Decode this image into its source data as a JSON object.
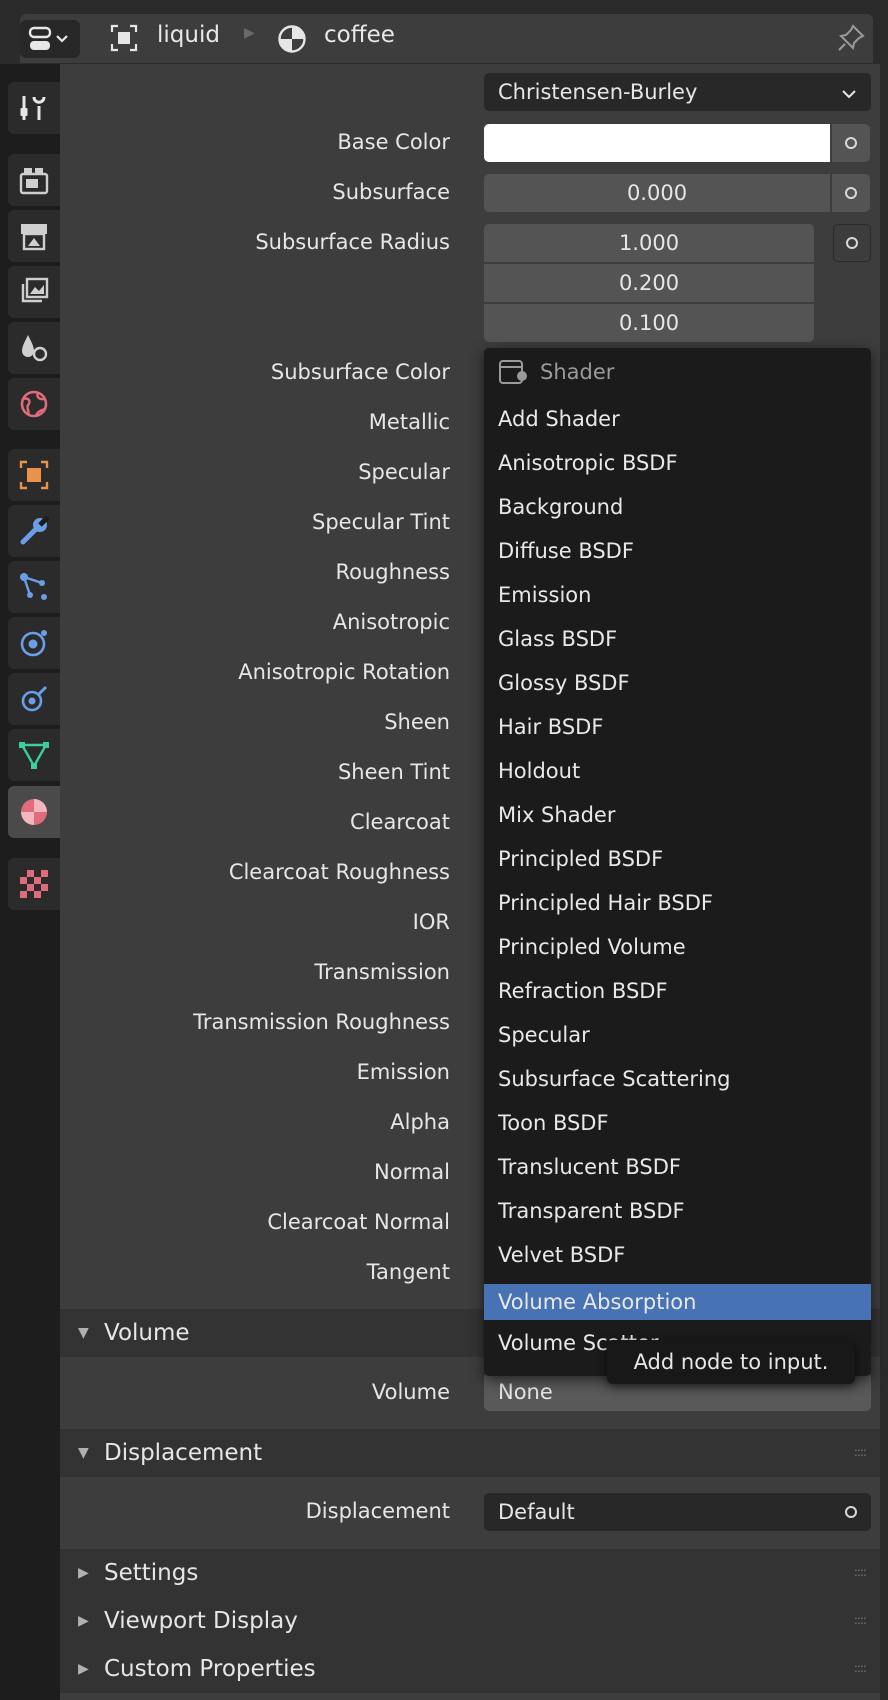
{
  "breadcrumb": {
    "object": "liquid",
    "material": "coffee"
  },
  "subsurface_method": "Christensen-Burley",
  "properties": {
    "base_color": {
      "label": "Base Color",
      "value": "#ffffff"
    },
    "subsurface": {
      "label": "Subsurface",
      "value": "0.000"
    },
    "subsurface_radius": {
      "label": "Subsurface Radius",
      "values": [
        "1.000",
        "0.200",
        "0.100"
      ]
    },
    "labels": [
      "Subsurface Color",
      "Metallic",
      "Specular",
      "Specular Tint",
      "Roughness",
      "Anisotropic",
      "Anisotropic Rotation",
      "Sheen",
      "Sheen Tint",
      "Clearcoat",
      "Clearcoat Roughness",
      "IOR",
      "Transmission",
      "Transmission Roughness",
      "Emission",
      "Alpha",
      "Normal",
      "Clearcoat Normal",
      "Tangent"
    ]
  },
  "menu": {
    "title": "Shader",
    "items": [
      "Add Shader",
      "Anisotropic BSDF",
      "Background",
      "Diffuse BSDF",
      "Emission",
      "Glass BSDF",
      "Glossy BSDF",
      "Hair BSDF",
      "Holdout",
      "Mix Shader",
      "Principled BSDF",
      "Principled Hair BSDF",
      "Principled Volume",
      "Refraction BSDF",
      "Specular",
      "Subsurface Scattering",
      "Toon BSDF",
      "Translucent BSDF",
      "Transparent BSDF",
      "Velvet BSDF",
      "Volume Absorption",
      "Volume Scatter"
    ],
    "highlighted": "Volume Absorption"
  },
  "tooltip": "Add node to input.",
  "panels": {
    "volume": {
      "title": "Volume",
      "label": "Volume",
      "value": "None"
    },
    "displacement": {
      "title": "Displacement",
      "label": "Displacement",
      "value": "Default"
    },
    "settings": "Settings",
    "viewport_display": "Viewport Display",
    "custom_properties": "Custom Properties"
  },
  "tabs": [
    "tool-icon",
    "render-icon",
    "output-icon",
    "view-layer-icon",
    "scene-icon",
    "world-icon",
    "object-icon",
    "modifier-icon",
    "particles-icon",
    "physics-icon",
    "constraints-icon",
    "data-icon",
    "material-icon",
    "texture-icon"
  ],
  "colors": {
    "highlight": "#4772b3",
    "material_tab": "#e06c7b",
    "object_tab": "#e8924a",
    "blue_icons": "#6a9ee8",
    "data_icon": "#3dcea0"
  }
}
